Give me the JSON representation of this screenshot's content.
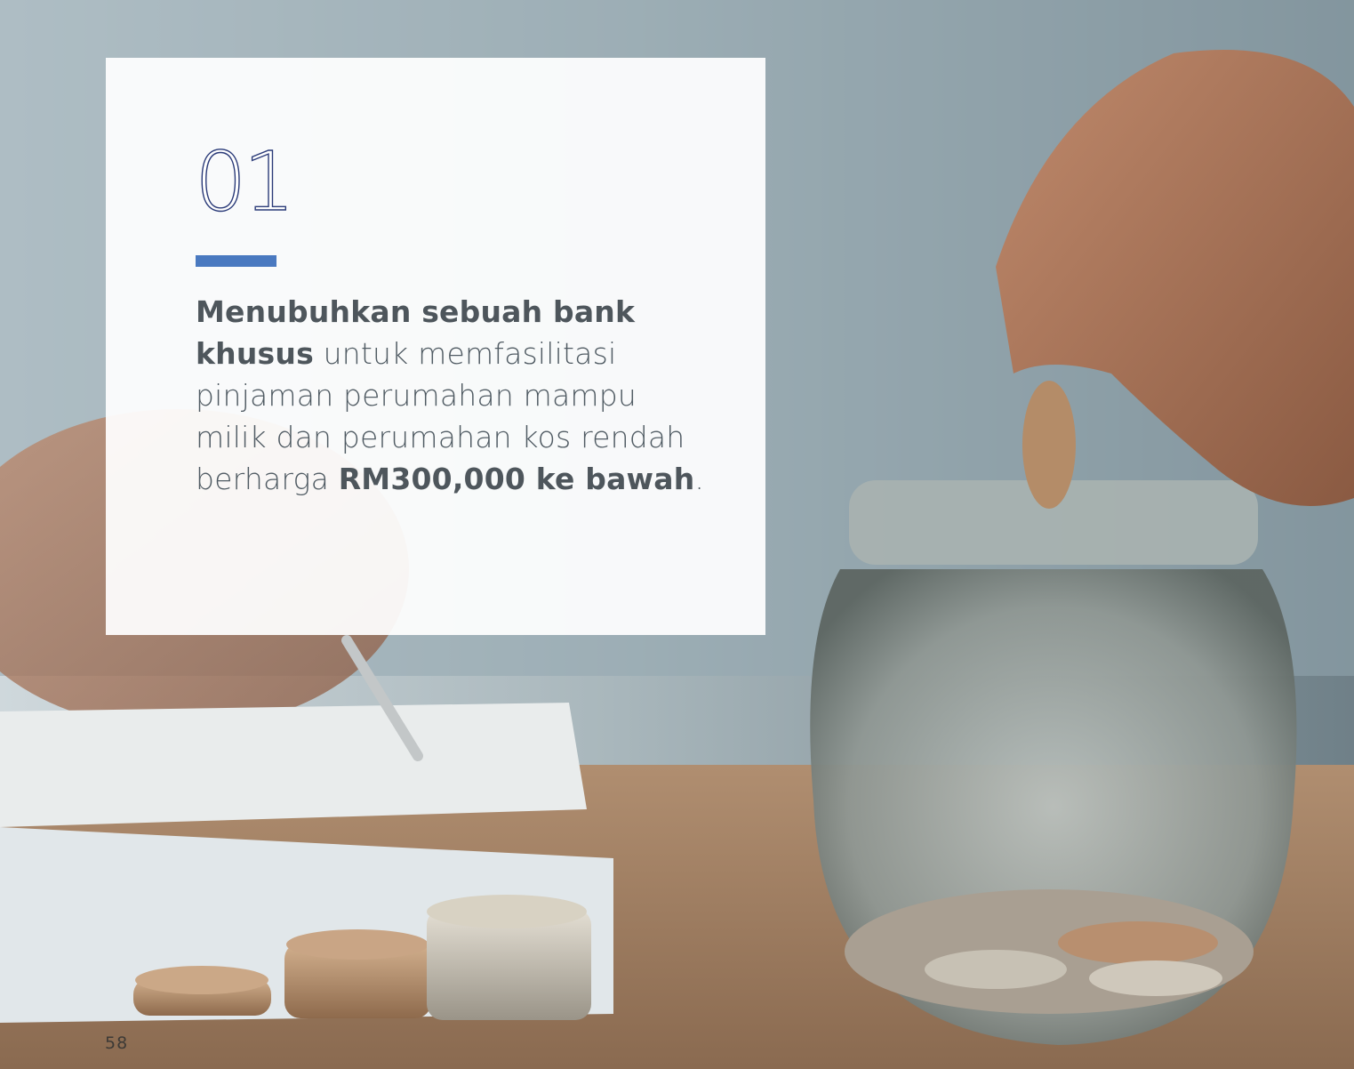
{
  "card": {
    "number": "01",
    "accent_color": "#4a79c0",
    "text": {
      "line1_bold": "Menubuhkan sebuah bank",
      "line2_bold": "khusus",
      "line2_regular": " untuk memfasilitasi",
      "line3": "pinjaman perumahan mampu",
      "line4": "milik dan perumahan kos rendah",
      "line5_regular": "berharga ",
      "line5_bold": "RM300,000 ke bawah",
      "line5_end": "."
    }
  },
  "footer": {
    "page_number": "58"
  }
}
